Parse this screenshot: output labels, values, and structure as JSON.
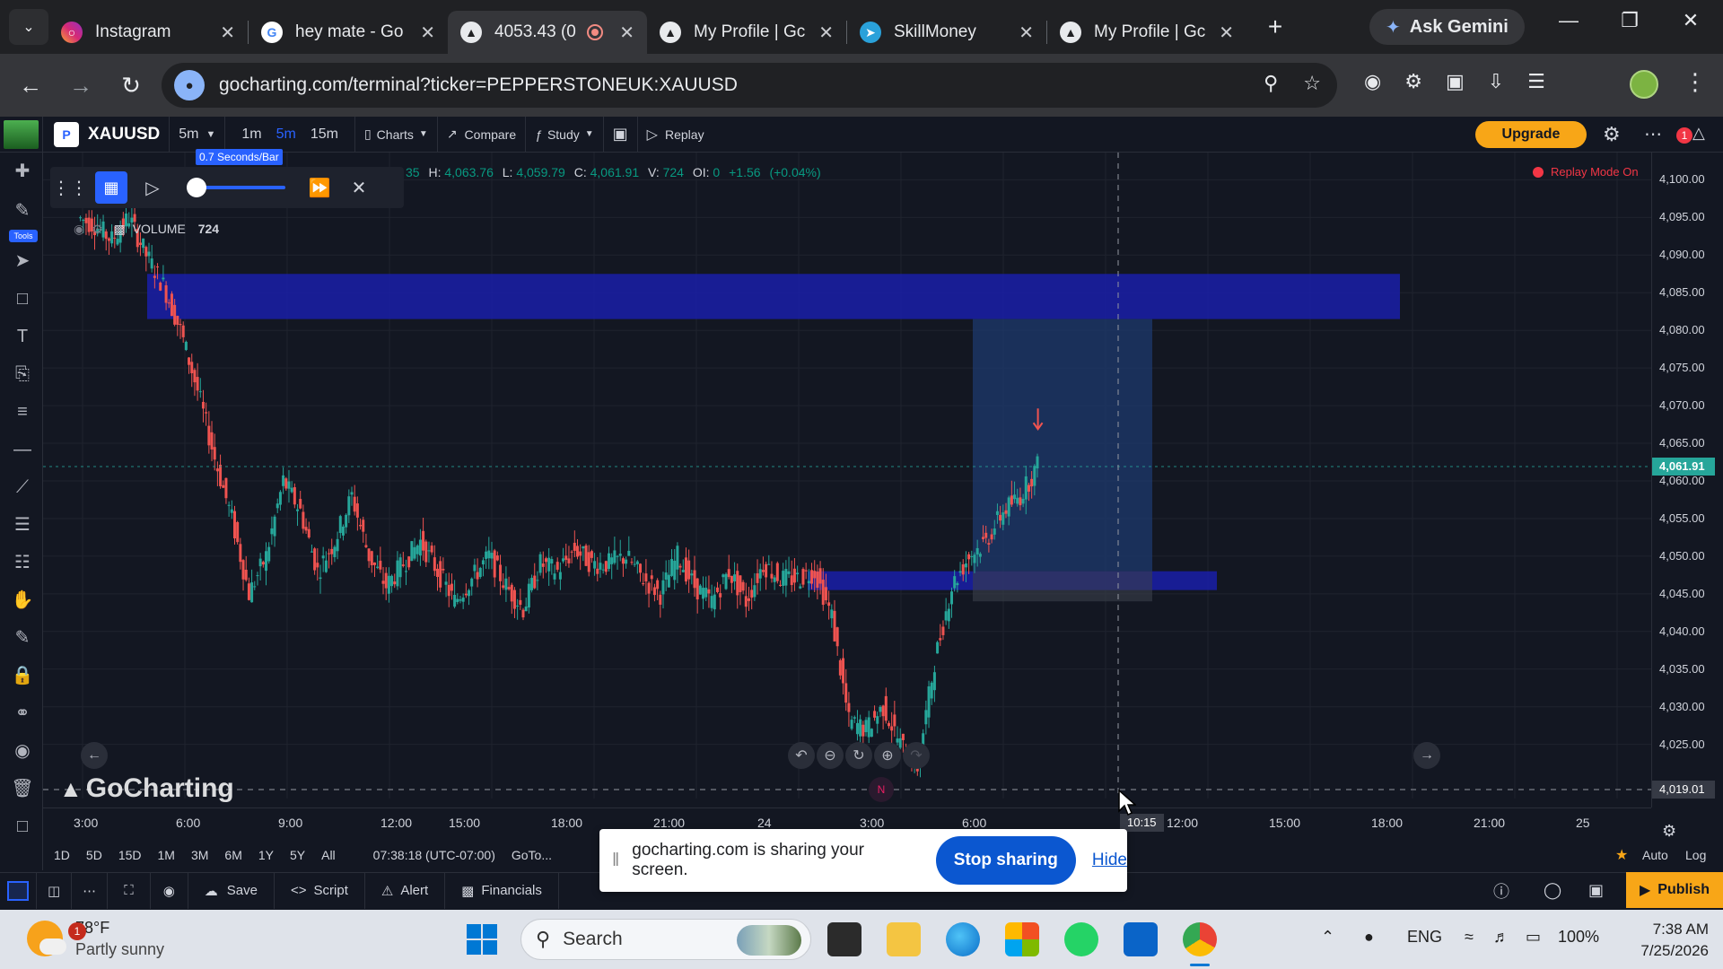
{
  "browser": {
    "tabs": [
      {
        "title": "Instagram",
        "active": false
      },
      {
        "title": "hey mate - Go",
        "active": false
      },
      {
        "title": "4053.43 (0",
        "active": true
      },
      {
        "title": "My Profile | Gc",
        "active": false
      },
      {
        "title": "SkillMoney",
        "active": false
      },
      {
        "title": "My Profile | Gc",
        "active": false
      }
    ],
    "ask_gemini": "Ask Gemini",
    "url": "gocharting.com/terminal?ticker=PEPPERSTONEUK:XAUUSD"
  },
  "toolbar": {
    "symbol": "XAUUSD",
    "interval": "5m",
    "timeframes": [
      "1m",
      "5m",
      "15m"
    ],
    "active_timeframe": "5m",
    "charts_label": "Charts",
    "compare_label": "Compare",
    "study_label": "Study",
    "replay_label": "Replay",
    "upgrade_label": "Upgrade",
    "notification_count": "1"
  },
  "left_tools": {
    "tools_badge": "Tools"
  },
  "replay": {
    "speed_tip": "0.7 Seconds/Bar",
    "mode_label": "Replay Mode On",
    "speed_fraction": 0.0
  },
  "legend": {
    "ohlc_prefix": "35",
    "h_label": "H:",
    "h_value": "4,063.76",
    "l_label": "L:",
    "l_value": "4,059.79",
    "c_label": "C:",
    "c_value": "4,061.91",
    "v_label": "V:",
    "v_value": "724",
    "oi_label": "OI:",
    "oi_value": "0",
    "change": "+1.56",
    "change_pct": "(+0.04%)",
    "volume_label": "VOLUME",
    "volume_value": "724"
  },
  "watermark": "GoCharting",
  "price_axis": {
    "ticks": [
      "4,100.00",
      "4,095.00",
      "4,090.00",
      "4,085.00",
      "4,080.00",
      "4,075.00",
      "4,070.00",
      "4,065.00",
      "4,060.00",
      "4,055.00",
      "4,050.00",
      "4,045.00",
      "4,040.00",
      "4,035.00",
      "4,030.00",
      "4,025.00"
    ],
    "last_price": "4,061.91",
    "crosshair_price": "4,019.01"
  },
  "time_axis": {
    "ticks": [
      "3:00",
      "6:00",
      "9:00",
      "12:00",
      "15:00",
      "18:00",
      "21:00",
      "24",
      "3:00",
      "6:00",
      "12:00",
      "15:00",
      "18:00",
      "21:00",
      "25"
    ],
    "crosshair_time": "10:15"
  },
  "chart_data": {
    "type": "candlestick",
    "symbol": "XAUUSD",
    "interval": "5m",
    "ylim": [
      4019,
      4101
    ],
    "y_ticks": [
      4025,
      4030,
      4035,
      4040,
      4045,
      4050,
      4055,
      4060,
      4065,
      4070,
      4075,
      4080,
      4085,
      4090,
      4095,
      4100
    ],
    "x_ticks": [
      "3:00",
      "6:00",
      "9:00",
      "12:00",
      "15:00",
      "18:00",
      "21:00",
      "24",
      "3:00",
      "6:00",
      "12:00",
      "15:00",
      "18:00",
      "21:00",
      "25"
    ],
    "series": [
      {
        "x_hours": [
          0,
          0.5,
          1,
          1.5,
          2,
          2.5,
          3,
          3.5,
          4,
          4.5,
          5,
          5.5,
          6,
          6.5,
          7,
          7.5,
          8,
          8.5,
          9,
          9.5,
          10,
          10.5,
          11,
          11.5,
          12,
          12.5,
          13,
          13.5,
          14,
          14.5,
          15,
          15.5,
          16,
          16.5,
          17,
          17.5,
          18,
          18.5,
          19,
          19.5,
          20,
          20.5,
          21,
          21.5,
          22,
          22.5,
          23,
          23.5,
          24,
          24.5,
          25,
          25.5,
          26,
          26.5,
          27,
          27.5,
          28
        ],
        "close": [
          4095,
          4094,
          4092,
          4095,
          4090,
          4086,
          4080,
          4072,
          4063,
          4055,
          4045,
          4050,
          4060,
          4056,
          4048,
          4052,
          4058,
          4050,
          4046,
          4049,
          4052,
          4048,
          4044,
          4047,
          4050,
          4046,
          4043,
          4049,
          4048,
          4051,
          4049,
          4049,
          4050,
          4047,
          4045,
          4050,
          4046,
          4044,
          4048,
          4044,
          4049,
          4047,
          4047,
          4048,
          4042,
          4028,
          4027,
          4030,
          4025,
          4022,
          4036,
          4046,
          4050,
          4052,
          4056,
          4058,
          4062
        ]
      }
    ],
    "last_price": 4061.91,
    "zones": [
      {
        "kind": "supply",
        "from": 4081.5,
        "to": 4087.5
      },
      {
        "kind": "demand",
        "from": 4045.5,
        "to": 4048
      }
    ],
    "position": {
      "entry": 4048,
      "target": 4081.5,
      "stop": 4044
    }
  },
  "range_bar": {
    "ranges": [
      "1D",
      "5D",
      "15D",
      "1M",
      "3M",
      "6M",
      "1Y",
      "5Y",
      "All"
    ],
    "clock": "07:38:18 (UTC-07:00)",
    "goto": "GoTo...",
    "auto": "Auto",
    "log": "Log"
  },
  "bottom_bar": {
    "save": "Save",
    "script": "Script",
    "alert": "Alert",
    "financials": "Financials",
    "publish": "Publish"
  },
  "share_notice": {
    "message": "gocharting.com is sharing your screen.",
    "stop": "Stop sharing",
    "hide": "Hide"
  },
  "taskbar": {
    "temp": "78°F",
    "weather": "Partly sunny",
    "weather_badge": "1",
    "search": "Search",
    "lang": "ENG",
    "battery": "100%",
    "time": "7:38 AM",
    "date": "7/25/2026"
  }
}
